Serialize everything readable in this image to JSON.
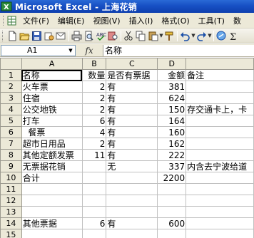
{
  "window": {
    "title": "Microsoft Excel - 上海花销"
  },
  "menu": {
    "items": [
      {
        "label": "文件(F)"
      },
      {
        "label": "编辑(E)"
      },
      {
        "label": "视图(V)"
      },
      {
        "label": "插入(I)"
      },
      {
        "label": "格式(O)"
      },
      {
        "label": "工具(T)"
      },
      {
        "label": "数"
      }
    ]
  },
  "toolbar": {
    "icons": [
      "new-icon",
      "open-icon",
      "save-icon",
      "permission-icon",
      "email-icon",
      "print-icon",
      "print-preview-icon",
      "spelling-icon",
      "research-icon",
      "cut-icon",
      "copy-icon",
      "paste-icon",
      "format-painter-icon",
      "undo-icon",
      "redo-icon",
      "hyperlink-icon",
      "autosum-icon"
    ]
  },
  "formula_bar": {
    "name_box": "A1",
    "fx_label": "fx",
    "content": "名称"
  },
  "sheet": {
    "columns": [
      "A",
      "B",
      "C",
      "D"
    ],
    "rows": [
      {
        "n": "1",
        "a": "名称",
        "b": "数量",
        "c": "是否有票据",
        "d": "金额",
        "e": "备注"
      },
      {
        "n": "2",
        "a": "火车票",
        "b": "2",
        "c": "有",
        "d": "381",
        "e": ""
      },
      {
        "n": "3",
        "a": "住宿",
        "b": "2",
        "c": "有",
        "d": "624",
        "e": ""
      },
      {
        "n": "4",
        "a": "公交地铁",
        "b": "2",
        "c": "有",
        "d": "150",
        "e": "存交通卡上，卡"
      },
      {
        "n": "5",
        "a": "打车",
        "b": "6",
        "c": "有",
        "d": "164",
        "e": ""
      },
      {
        "n": "6",
        "a": "  餐票",
        "b": "4",
        "c": "有",
        "d": "160",
        "e": ""
      },
      {
        "n": "7",
        "a": "超市日用品",
        "b": "2",
        "c": "有",
        "d": "162",
        "e": ""
      },
      {
        "n": "8",
        "a": "其他定额发票",
        "b": "11",
        "c": "有",
        "d": "222",
        "e": ""
      },
      {
        "n": "9",
        "a": "无票据花销",
        "b": "",
        "c": "无",
        "d": "337",
        "e": "内含去宁波给道"
      },
      {
        "n": "10",
        "a": "合计",
        "b": "",
        "c": "",
        "d": "2200",
        "e": ""
      },
      {
        "n": "11",
        "a": "",
        "b": "",
        "c": "",
        "d": "",
        "e": ""
      },
      {
        "n": "12",
        "a": "",
        "b": "",
        "c": "",
        "d": "",
        "e": ""
      },
      {
        "n": "13",
        "a": "",
        "b": "",
        "c": "",
        "d": "",
        "e": ""
      },
      {
        "n": "14",
        "a": "其他票据",
        "b": "6",
        "c": "有",
        "d": "600",
        "e": ""
      },
      {
        "n": "15",
        "a": "",
        "b": "",
        "c": "",
        "d": "",
        "e": ""
      }
    ]
  }
}
